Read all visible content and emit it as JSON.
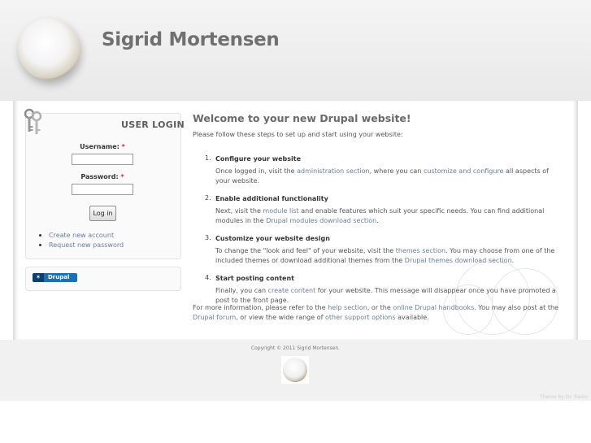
{
  "site": {
    "name": "Sigrid Mortensen"
  },
  "login": {
    "title": "USER LOGIN",
    "username_label": "Username:",
    "password_label": "Password:",
    "required_mark": "*",
    "username_value": "",
    "password_value": "",
    "submit_label": "Log in",
    "links": [
      "Create new account",
      "Request new password"
    ]
  },
  "powered_by": {
    "drop": "✶",
    "label": "Drupal"
  },
  "main": {
    "title": "Welcome to your new Drupal website!",
    "intro": "Please follow these steps to set up and start using your website:",
    "steps": [
      {
        "number": "1.",
        "title": "Configure your website",
        "text_before": "Once logged in, visit the ",
        "link1": "administration section",
        "text_middle": ", where you can ",
        "link2": "customize and configure",
        "text_after": " all aspects of your website."
      },
      {
        "number": "2.",
        "title": "Enable additional functionality",
        "text_before": "Next, visit the ",
        "link1": "module list",
        "text_middle": " and enable features which suit your specific needs. You can find additional modules in the ",
        "link2": "Drupal modules download section",
        "text_after": "."
      },
      {
        "number": "3.",
        "title": "Customize your website design",
        "text_before": "To change the \"look and feel\" of your website, visit the ",
        "link1": "themes section",
        "text_middle": ". You may choose from one of the included themes or download additional themes from the ",
        "link2": "Drupal themes download section",
        "text_after": "."
      },
      {
        "number": "4.",
        "title": "Start posting content",
        "text_before": "Finally, you can ",
        "link1": "create content",
        "text_middle": " for your website. This message will disappear once you have promoted a post to the front page.",
        "link2": "",
        "text_after": ""
      }
    ],
    "footer_text": {
      "t1": "For more information, please refer to the ",
      "l1": "help section",
      "t2": ", or the ",
      "l2": "online Drupal handbooks",
      "t3": ". You may also post at the ",
      "l3": "Drupal forum",
      "t4": ", or view the wide range of ",
      "l4": "other support options",
      "t5": " available."
    }
  },
  "footer": {
    "copyright": "Copyright © 2011 Sigrid Mortensen.",
    "theme_credit": "Theme by Dr. Radio"
  }
}
